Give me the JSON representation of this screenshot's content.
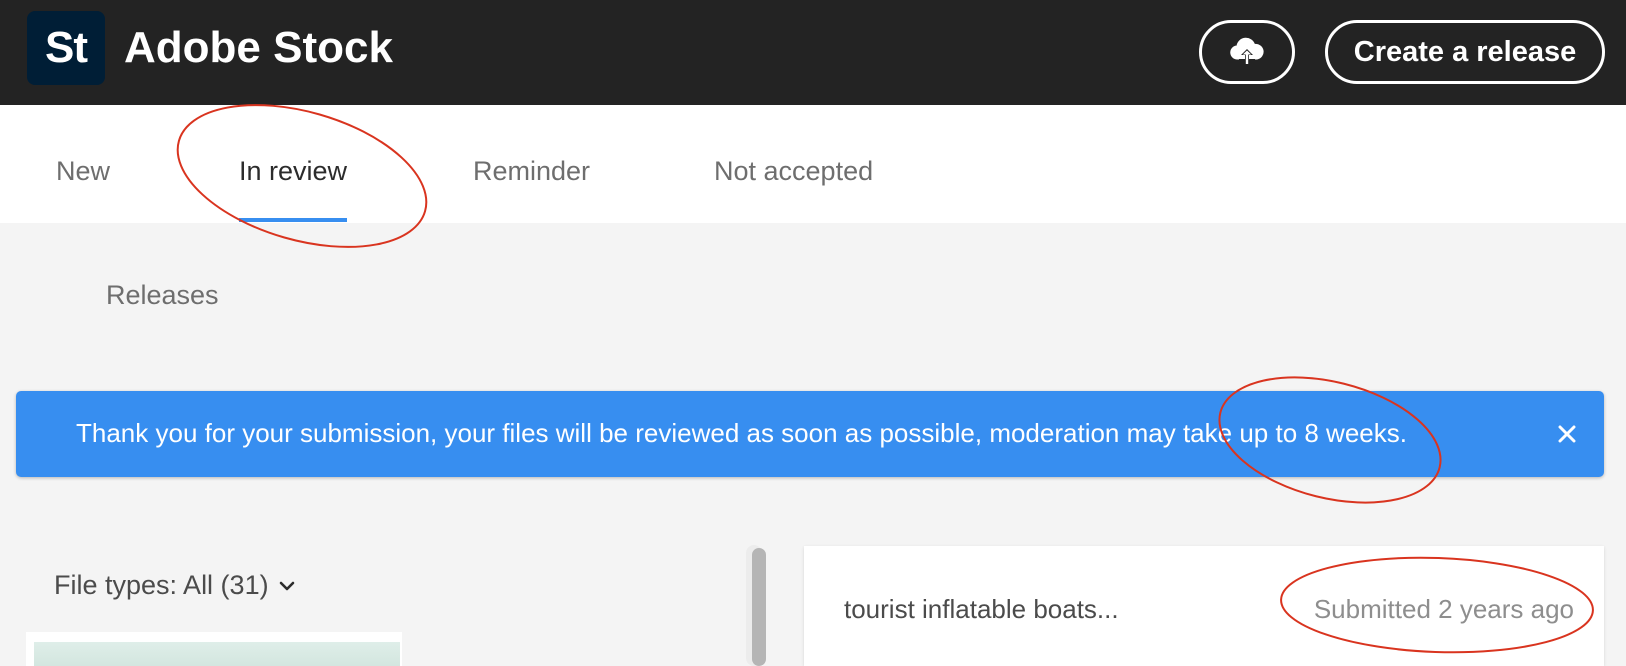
{
  "header": {
    "logo_text": "St",
    "title": "Adobe Stock",
    "upload_icon": "cloud-upload-icon",
    "create_release_label": "Create a release"
  },
  "tabs": [
    {
      "label": "New",
      "active": false
    },
    {
      "label": "In review",
      "active": true
    },
    {
      "label": "Reminder",
      "active": false
    },
    {
      "label": "Not accepted",
      "active": false
    }
  ],
  "sub_tab": {
    "label": "Releases"
  },
  "banner": {
    "message": "Thank you for your submission, your files will be reviewed as soon as possible, moderation may take up to 8 weeks.",
    "close_icon": "close-icon",
    "color": "#378ef0"
  },
  "filter": {
    "label": "File types: All (31)",
    "icon": "chevron-down-icon"
  },
  "detail": {
    "title": "tourist inflatable boats...",
    "status": "Submitted 2 years ago"
  },
  "colors": {
    "header_bg": "#232323",
    "accent": "#378ef0",
    "annotation": "#d9341f"
  }
}
